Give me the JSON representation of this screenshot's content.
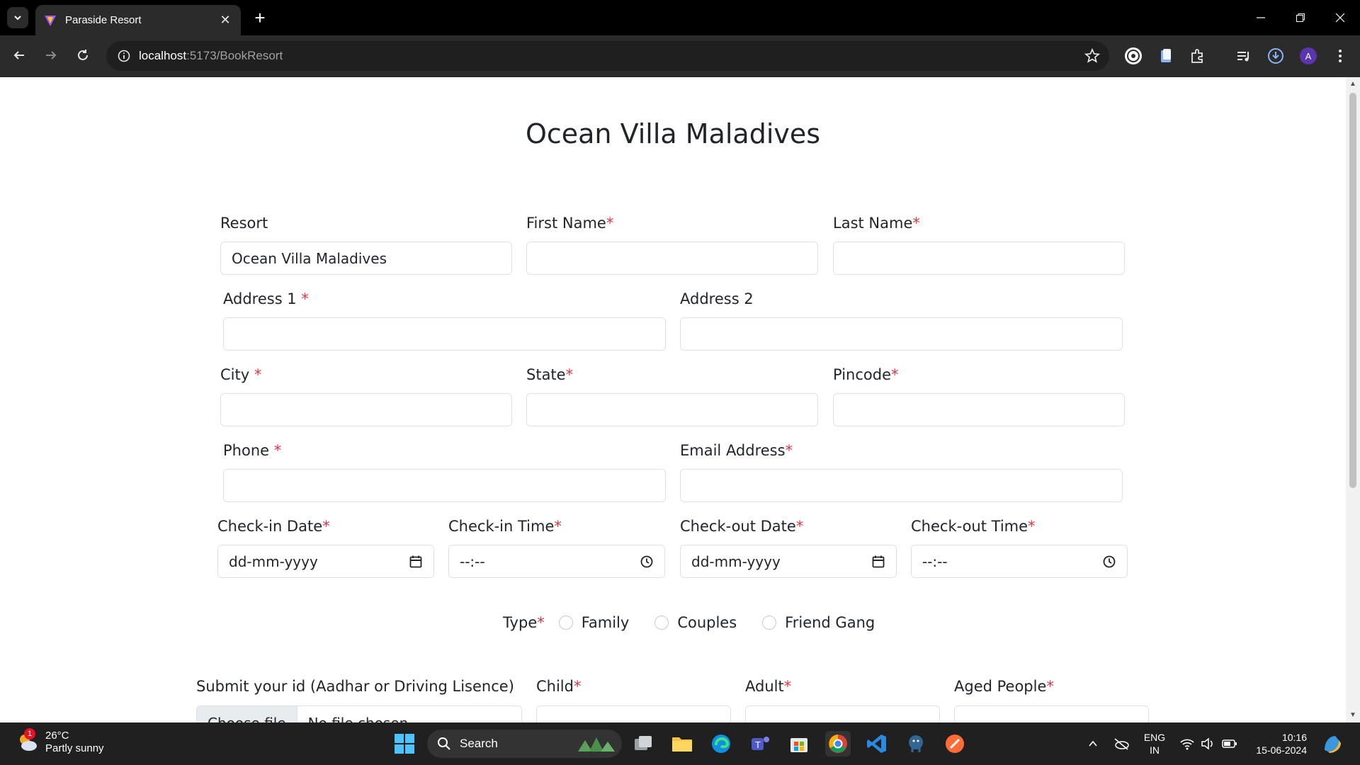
{
  "browser": {
    "tab_title": "Paraside Resort",
    "url_host": "localhost",
    "url_path": ":5173/BookResort",
    "profile_initial": "A"
  },
  "page": {
    "heading": "Ocean Villa Maladives",
    "required_mark": "*",
    "fields": {
      "resort": {
        "label": "Resort",
        "value": "Ocean Villa Maladives"
      },
      "first_name": {
        "label": "First Name"
      },
      "last_name": {
        "label": "Last Name"
      },
      "address1": {
        "label": "Address 1 "
      },
      "address2": {
        "label": "Address 2"
      },
      "city": {
        "label": "City "
      },
      "state": {
        "label": "State"
      },
      "pincode": {
        "label": "Pincode"
      },
      "phone": {
        "label": "Phone "
      },
      "email": {
        "label": "Email Address"
      },
      "checkin_date": {
        "label": "Check-in Date",
        "value": "dd-mm-yyyy"
      },
      "checkin_time": {
        "label": "Check-in Time",
        "value": "--:--"
      },
      "checkout_date": {
        "label": "Check-out Date",
        "value": "dd-mm-yyyy"
      },
      "checkout_time": {
        "label": "Check-out Time",
        "value": "--:--"
      },
      "type": {
        "label": "Type",
        "options": [
          "Family",
          "Couples",
          "Friend Gang"
        ]
      },
      "id_upload": {
        "label": "Submit your id (Aadhar or Driving Lisence)",
        "button": "Choose file",
        "status": "No file chosen"
      },
      "child": {
        "label": "Child"
      },
      "adult": {
        "label": "Adult"
      },
      "aged": {
        "label": "Aged People"
      }
    }
  },
  "taskbar": {
    "weather_temp": "26°C",
    "weather_desc": "Partly sunny",
    "weather_badge": "1",
    "search_label": "Search",
    "lang_top": "ENG",
    "lang_bottom": "IN",
    "time": "10:16",
    "date": "15-06-2024"
  },
  "colors": {
    "required": "#dc3545",
    "tab_bg": "#2b2b2b",
    "taskbar_bg": "#202020"
  }
}
